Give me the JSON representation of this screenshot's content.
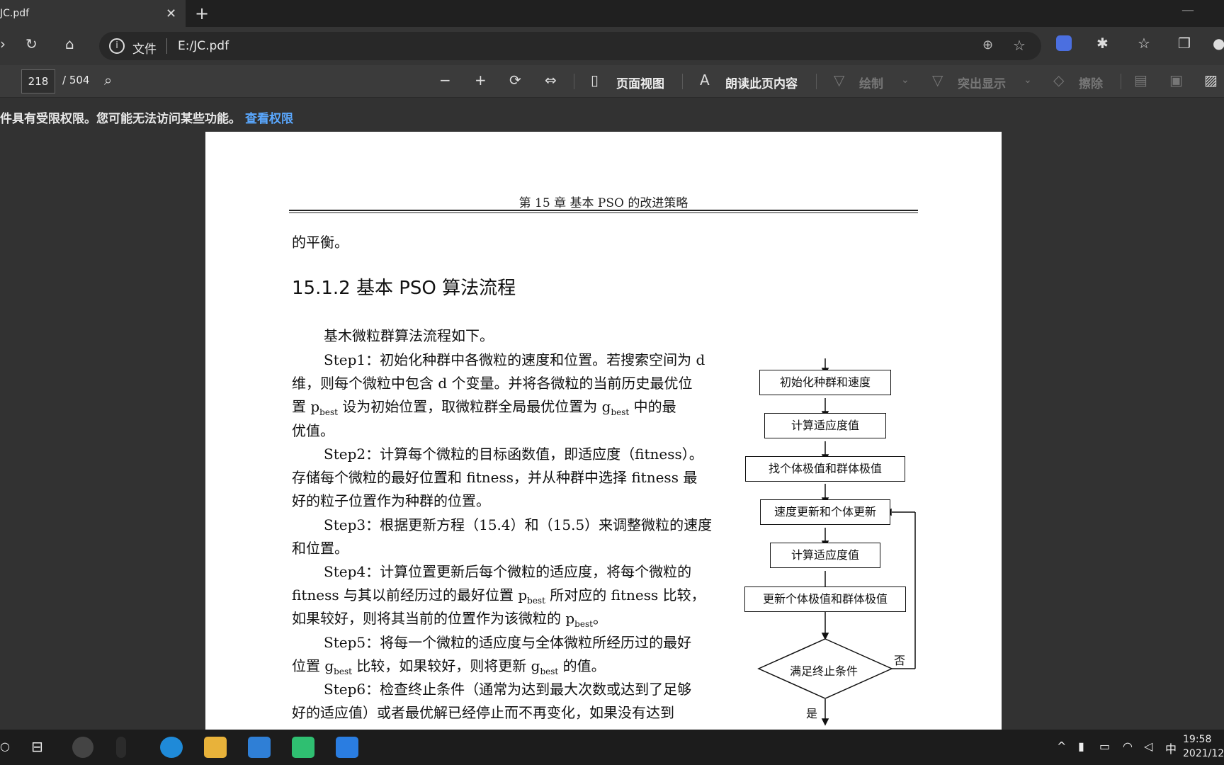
{
  "tab": {
    "title": "JC.pdf",
    "close": "✕",
    "new": "+"
  },
  "address": {
    "scheme": "文件",
    "url": "E:/JC.pdf"
  },
  "pdf_toolbar": {
    "page_current": "218",
    "page_total": "/ 504",
    "page_view": "页面视图",
    "read_aloud": "朗读此页内容",
    "draw": "绘制",
    "highlight": "突出显示",
    "erase": "擦除"
  },
  "notice": {
    "message": "件具有受限权限。您可能无法访问某些功能。",
    "link": "查看权限"
  },
  "document": {
    "running_header": "第 15 章   基本 PSO 的改进策略",
    "line_prev": "的平衡。",
    "section_title": "15.1.2   基本 PSO 算法流程",
    "intro": "基木微粒群算法流程如下。",
    "step1_l1": "Step1：初始化种群中各微粒的速度和位置。若搜索空间为 d",
    "step1_l2": "维，则每个微粒中包含 d 个变量。并将各微粒的当前历史最优位",
    "step1_l3a": "置 p",
    "step1_l3b": " 设为初始位置，取微粒群全局最优位置为 g",
    "step1_l3c": " 中的最",
    "sub_best": "best",
    "step1_l4": "优值。",
    "step2_l1": "Step2：计算每个微粒的目标函数值，即适应度（fitness）。",
    "step2_l2": "存储每个微粒的最好位置和 fitness，并从种群中选择 fitness 最",
    "step2_l3": "好的粒子位置作为种群的位置。",
    "step3_l1": "Step3：根据更新方程（15.4）和（15.5）来调整微粒的速度",
    "step3_l2": "和位置。",
    "step4_l1": "Step4：计算位置更新后每个微粒的适应度，将每个微粒的",
    "step4_l2a": "fitness 与其以前经历过的最好位置 p",
    "step4_l2b": " 所对应的 fitness 比较，",
    "step4_l3a": "如果较好，则将其当前的位置作为该微粒的 p",
    "step4_l3b": "。",
    "step5_l1": "Step5：将每一个微粒的适应度与全体微粒所经历过的最好",
    "step5_l2a": "位置 g",
    "step5_l2b": " 比较，如果较好，则将更新 g",
    "step5_l2c": " 的值。",
    "step6_l1": "Step6：检查终止条件（通常为达到最大次数或达到了足够",
    "step6_l2": "好的适应值）或者最优解已经停止而不再变化，如果没有达到"
  },
  "flowchart": {
    "init": "初始化种群和速度",
    "fitness1": "计算适应度值",
    "find": "找个体极值和群体极值",
    "update": "速度更新和个体更新",
    "fitness2": "计算适应度值",
    "update_best": "更新个体极值和群体极值",
    "decision": "满足终止条件",
    "no": "否",
    "yes": "是"
  },
  "clock": {
    "time": "19:58",
    "date": "2021/12"
  },
  "tray": {
    "ime": "中"
  },
  "colors": {
    "link": "#5aa8ff",
    "page_bg": "#ffffff",
    "chrome_bg": "#323232"
  }
}
